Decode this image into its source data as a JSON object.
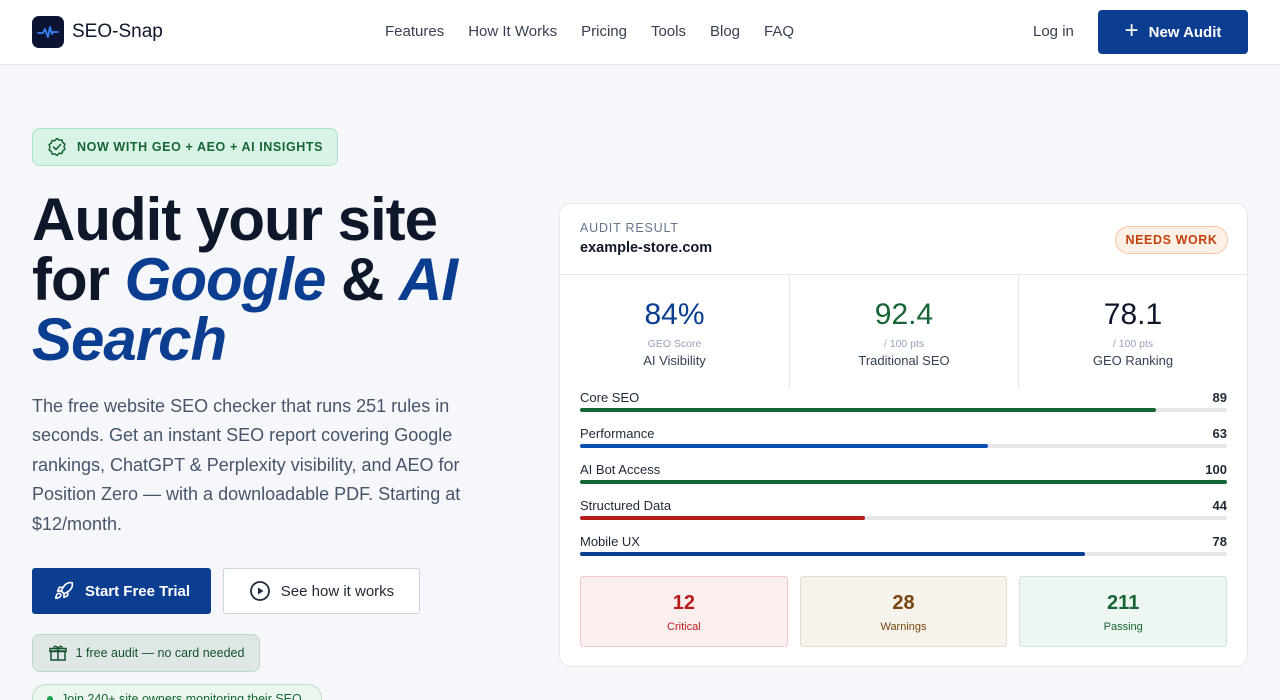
{
  "brand": {
    "name": "SEO-Snap"
  },
  "nav": {
    "links": [
      "Features",
      "How It Works",
      "Pricing",
      "Tools",
      "Blog",
      "FAQ"
    ],
    "login": "Log in",
    "cta": "New Audit"
  },
  "hero": {
    "badge": "NOW WITH GEO + AEO + AI INSIGHTS",
    "headline": {
      "line1": "Audit your site",
      "for": "for",
      "google": "Google",
      "amp": "&",
      "ai": "AI",
      "search": "Search"
    },
    "description": "The free website SEO checker that runs 251 rules in seconds. Get an instant SEO report covering Google rankings, ChatGPT & Perplexity visibility, and AEO for Position Zero — with a downloadable PDF. Starting at $12/month.",
    "primary_button": "Start Free Trial",
    "secondary_button": "See how it works",
    "free_note": "1 free audit — no card needed",
    "join_note": "Join 240+ site owners monitoring their SEO"
  },
  "audit_card": {
    "label": "AUDIT RESULT",
    "domain": "example-store.com",
    "status": "NEEDS WORK",
    "metrics": [
      {
        "value": "84%",
        "sub": "GEO Score",
        "label": "AI Visibility",
        "color": "#0b3d91"
      },
      {
        "value": "92.4",
        "sub": "/ 100 pts",
        "label": "Traditional SEO",
        "color": "#166534"
      },
      {
        "value": "78.1",
        "sub": "/ 100 pts",
        "label": "GEO Ranking",
        "color": "#0f172a"
      }
    ],
    "categories": [
      {
        "name": "Core SEO",
        "score": 89,
        "color": "#166534"
      },
      {
        "name": "Performance",
        "score": 63,
        "color": "#0b4fb3"
      },
      {
        "name": "AI Bot Access",
        "score": 100,
        "color": "#166534"
      },
      {
        "name": "Structured Data",
        "score": 44,
        "color": "#b91c1c"
      },
      {
        "name": "Mobile UX",
        "score": 78,
        "color": "#0b3d91"
      }
    ],
    "stats": [
      {
        "count": "12",
        "label": "Critical",
        "color": "#b91c1c",
        "bg": "#fbeeee",
        "border": "#f1c9c9"
      },
      {
        "count": "28",
        "label": "Warnings",
        "color": "#78450f",
        "bg": "#f6f2ec",
        "border": "#e6dccd"
      },
      {
        "count": "211",
        "label": "Passing",
        "color": "#166534",
        "bg": "#eef6f1",
        "border": "#cfe5d8"
      }
    ]
  }
}
